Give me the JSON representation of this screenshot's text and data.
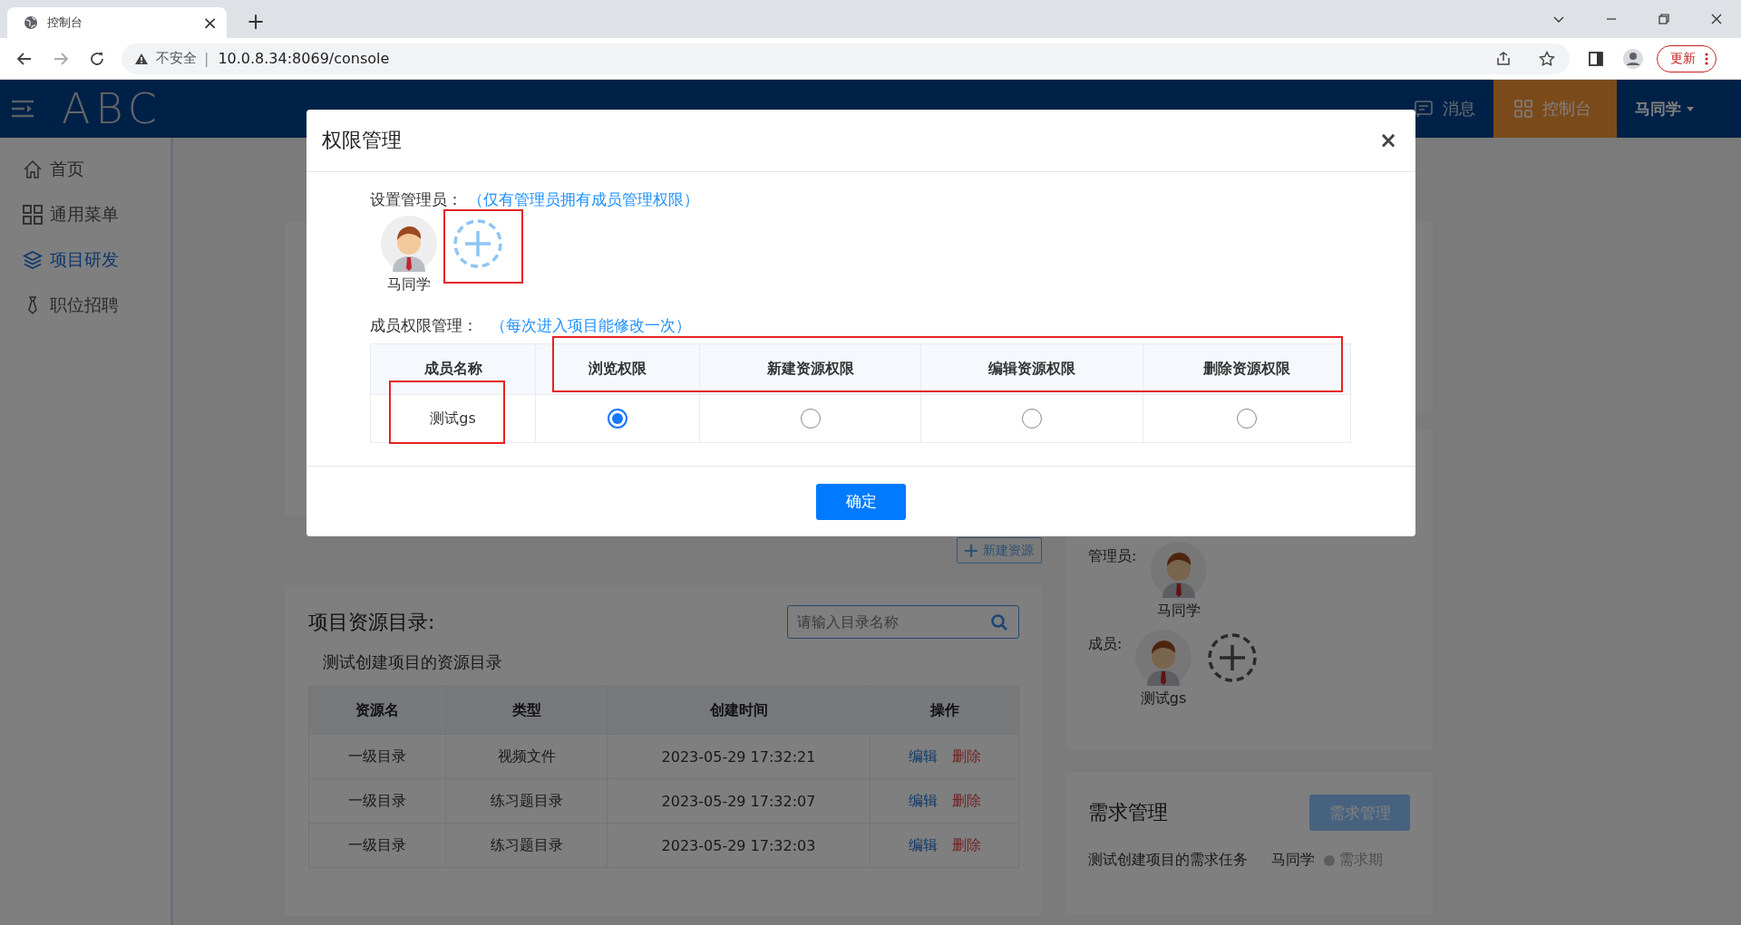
{
  "browser": {
    "tab": {
      "title": "控制台",
      "close": "×"
    },
    "new_tab": "+",
    "address": {
      "security": "不安全",
      "separator": "|",
      "url": "10.0.8.34:8069/console"
    },
    "update_button": "更新"
  },
  "header": {
    "logo": "ABC",
    "nav": [
      {
        "kind": "message",
        "label": "消息",
        "selected": false
      },
      {
        "kind": "console",
        "label": "控制台",
        "selected": true
      }
    ],
    "user": "马同学"
  },
  "sidebar": {
    "items": [
      {
        "kind": "home",
        "label": "首页",
        "selected": false
      },
      {
        "kind": "grid",
        "label": "通用菜单",
        "selected": false
      },
      {
        "kind": "layers",
        "label": "项目研发",
        "selected": true
      },
      {
        "kind": "tie",
        "label": "职位招聘",
        "selected": false
      }
    ]
  },
  "new_resource_button": "新建资源",
  "resource_panel": {
    "title": "项目资源目录:",
    "search": {
      "placeholder": "请输入目录名称"
    },
    "subtitle": "测试创建项目的资源目录",
    "columns": [
      "资源名",
      "类型",
      "创建时间",
      "操作"
    ],
    "rows": [
      {
        "name": "一级目录",
        "type": "视频文件",
        "created": "2023-05-29 17:32:21",
        "actions": [
          {
            "kind": "edit",
            "label": "编辑"
          },
          {
            "kind": "delete",
            "label": "删除"
          }
        ]
      },
      {
        "name": "一级目录",
        "type": "练习题目录",
        "created": "2023-05-29 17:32:07",
        "actions": [
          {
            "kind": "edit",
            "label": "编辑"
          },
          {
            "kind": "delete",
            "label": "删除"
          }
        ]
      },
      {
        "name": "一级目录",
        "type": "练习题目录",
        "created": "2023-05-29 17:32:03",
        "actions": [
          {
            "kind": "edit",
            "label": "编辑"
          },
          {
            "kind": "delete",
            "label": "删除"
          }
        ]
      }
    ]
  },
  "members_panel": {
    "admin_label": "管理员:",
    "admins": [
      {
        "name": "马同学"
      }
    ],
    "member_label": "成员:",
    "members": [
      {
        "name": "测试gs"
      }
    ]
  },
  "demand_panel": {
    "title": "需求管理",
    "button": "需求管理",
    "tasks": [
      {
        "name": "测试创建项目的需求任务",
        "owner": "马同学",
        "status": "需求期"
      }
    ]
  },
  "modal": {
    "title": "权限管理",
    "close": "×",
    "admin_section": {
      "label": "设置管理员：",
      "hint": "（仅有管理员拥有成员管理权限）",
      "admins": [
        {
          "name": "马同学"
        }
      ],
      "add_highlighted": true
    },
    "member_section": {
      "label": "成员权限管理：",
      "hint": "（每次进入项目能修改一次）",
      "columns": [
        "成员名称",
        "浏览权限",
        "新建资源权限",
        "编辑资源权限",
        "删除资源权限"
      ],
      "headers_highlighted": true,
      "rows": [
        {
          "name": "测试gs",
          "name_highlighted": true,
          "permissions": [
            {
              "selected": true
            },
            {
              "selected": false
            },
            {
              "selected": false
            },
            {
              "selected": false
            }
          ]
        }
      ]
    },
    "confirm_button": "确定"
  }
}
